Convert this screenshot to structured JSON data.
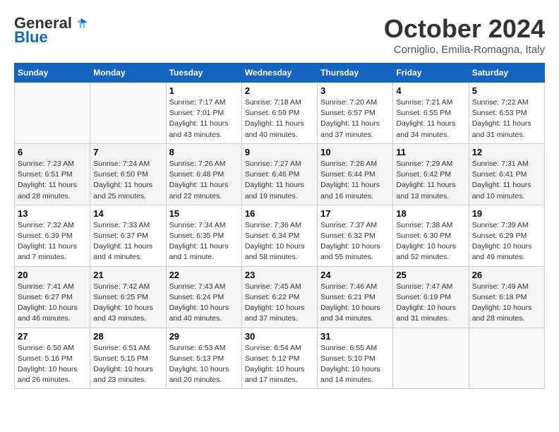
{
  "header": {
    "logo_line1": "General",
    "logo_line2": "Blue",
    "month": "October 2024",
    "location": "Corniglio, Emilia-Romagna, Italy"
  },
  "weekdays": [
    "Sunday",
    "Monday",
    "Tuesday",
    "Wednesday",
    "Thursday",
    "Friday",
    "Saturday"
  ],
  "weeks": [
    [
      {
        "day": "",
        "info": ""
      },
      {
        "day": "",
        "info": ""
      },
      {
        "day": "1",
        "info": "Sunrise: 7:17 AM\nSunset: 7:01 PM\nDaylight: 11 hours and 43 minutes."
      },
      {
        "day": "2",
        "info": "Sunrise: 7:18 AM\nSunset: 6:59 PM\nDaylight: 11 hours and 40 minutes."
      },
      {
        "day": "3",
        "info": "Sunrise: 7:20 AM\nSunset: 6:57 PM\nDaylight: 11 hours and 37 minutes."
      },
      {
        "day": "4",
        "info": "Sunrise: 7:21 AM\nSunset: 6:55 PM\nDaylight: 11 hours and 34 minutes."
      },
      {
        "day": "5",
        "info": "Sunrise: 7:22 AM\nSunset: 6:53 PM\nDaylight: 11 hours and 31 minutes."
      }
    ],
    [
      {
        "day": "6",
        "info": "Sunrise: 7:23 AM\nSunset: 6:51 PM\nDaylight: 11 hours and 28 minutes."
      },
      {
        "day": "7",
        "info": "Sunrise: 7:24 AM\nSunset: 6:50 PM\nDaylight: 11 hours and 25 minutes."
      },
      {
        "day": "8",
        "info": "Sunrise: 7:26 AM\nSunset: 6:48 PM\nDaylight: 11 hours and 22 minutes."
      },
      {
        "day": "9",
        "info": "Sunrise: 7:27 AM\nSunset: 6:46 PM\nDaylight: 11 hours and 19 minutes."
      },
      {
        "day": "10",
        "info": "Sunrise: 7:28 AM\nSunset: 6:44 PM\nDaylight: 11 hours and 16 minutes."
      },
      {
        "day": "11",
        "info": "Sunrise: 7:29 AM\nSunset: 6:42 PM\nDaylight: 11 hours and 13 minutes."
      },
      {
        "day": "12",
        "info": "Sunrise: 7:31 AM\nSunset: 6:41 PM\nDaylight: 11 hours and 10 minutes."
      }
    ],
    [
      {
        "day": "13",
        "info": "Sunrise: 7:32 AM\nSunset: 6:39 PM\nDaylight: 11 hours and 7 minutes."
      },
      {
        "day": "14",
        "info": "Sunrise: 7:33 AM\nSunset: 6:37 PM\nDaylight: 11 hours and 4 minutes."
      },
      {
        "day": "15",
        "info": "Sunrise: 7:34 AM\nSunset: 6:35 PM\nDaylight: 11 hours and 1 minute."
      },
      {
        "day": "16",
        "info": "Sunrise: 7:36 AM\nSunset: 6:34 PM\nDaylight: 10 hours and 58 minutes."
      },
      {
        "day": "17",
        "info": "Sunrise: 7:37 AM\nSunset: 6:32 PM\nDaylight: 10 hours and 55 minutes."
      },
      {
        "day": "18",
        "info": "Sunrise: 7:38 AM\nSunset: 6:30 PM\nDaylight: 10 hours and 52 minutes."
      },
      {
        "day": "19",
        "info": "Sunrise: 7:39 AM\nSunset: 6:29 PM\nDaylight: 10 hours and 49 minutes."
      }
    ],
    [
      {
        "day": "20",
        "info": "Sunrise: 7:41 AM\nSunset: 6:27 PM\nDaylight: 10 hours and 46 minutes."
      },
      {
        "day": "21",
        "info": "Sunrise: 7:42 AM\nSunset: 6:25 PM\nDaylight: 10 hours and 43 minutes."
      },
      {
        "day": "22",
        "info": "Sunrise: 7:43 AM\nSunset: 6:24 PM\nDaylight: 10 hours and 40 minutes."
      },
      {
        "day": "23",
        "info": "Sunrise: 7:45 AM\nSunset: 6:22 PM\nDaylight: 10 hours and 37 minutes."
      },
      {
        "day": "24",
        "info": "Sunrise: 7:46 AM\nSunset: 6:21 PM\nDaylight: 10 hours and 34 minutes."
      },
      {
        "day": "25",
        "info": "Sunrise: 7:47 AM\nSunset: 6:19 PM\nDaylight: 10 hours and 31 minutes."
      },
      {
        "day": "26",
        "info": "Sunrise: 7:49 AM\nSunset: 6:18 PM\nDaylight: 10 hours and 28 minutes."
      }
    ],
    [
      {
        "day": "27",
        "info": "Sunrise: 6:50 AM\nSunset: 5:16 PM\nDaylight: 10 hours and 26 minutes."
      },
      {
        "day": "28",
        "info": "Sunrise: 6:51 AM\nSunset: 5:15 PM\nDaylight: 10 hours and 23 minutes."
      },
      {
        "day": "29",
        "info": "Sunrise: 6:53 AM\nSunset: 5:13 PM\nDaylight: 10 hours and 20 minutes."
      },
      {
        "day": "30",
        "info": "Sunrise: 6:54 AM\nSunset: 5:12 PM\nDaylight: 10 hours and 17 minutes."
      },
      {
        "day": "31",
        "info": "Sunrise: 6:55 AM\nSunset: 5:10 PM\nDaylight: 10 hours and 14 minutes."
      },
      {
        "day": "",
        "info": ""
      },
      {
        "day": "",
        "info": ""
      }
    ]
  ]
}
